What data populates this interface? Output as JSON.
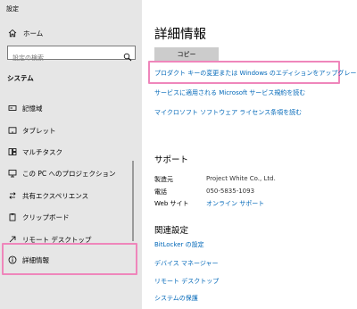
{
  "window": {
    "title": "設定"
  },
  "sidebar": {
    "home_label": "ホーム",
    "search_placeholder": "設定の検索",
    "section_title": "システム",
    "items": [
      {
        "label": "記憶域",
        "icon": "storage-icon"
      },
      {
        "label": "タブレット",
        "icon": "tablet-icon"
      },
      {
        "label": "マルチタスク",
        "icon": "multitasking-icon"
      },
      {
        "label": "この PC へのプロジェクション",
        "icon": "projection-icon"
      },
      {
        "label": "共有エクスペリエンス",
        "icon": "shared-experiences-icon"
      },
      {
        "label": "クリップボード",
        "icon": "clipboard-icon"
      },
      {
        "label": "リモート デスクトップ",
        "icon": "remote-desktop-icon"
      },
      {
        "label": "詳細情報",
        "icon": "info-icon",
        "selected": true
      }
    ]
  },
  "main": {
    "title": "詳細情報",
    "copy_button": "コピー",
    "links_top": [
      "プロダクト キーの変更または Windows のエディションをアップグレード",
      "サービスに適用される Microsoft サービス規約を読む",
      "マイクロソフト ソフトウェア ライセンス条項を読む"
    ],
    "support": {
      "heading": "サポート",
      "rows": [
        {
          "label": "製造元",
          "value": "Project White Co., Ltd."
        },
        {
          "label": "電話",
          "value": "050-5835-1093"
        },
        {
          "label": "Web サイト",
          "value": "オンライン サポート"
        }
      ]
    },
    "related": {
      "heading": "関連設定",
      "links": [
        "BitLocker の設定",
        "デバイス マネージャー",
        "リモート デスクトップ",
        "システムの保護"
      ]
    }
  },
  "colors": {
    "sidebar_bg": "#e6e6e6",
    "link": "#0067b8",
    "highlight": "#ef86bb",
    "button_bg": "#cccccc"
  }
}
